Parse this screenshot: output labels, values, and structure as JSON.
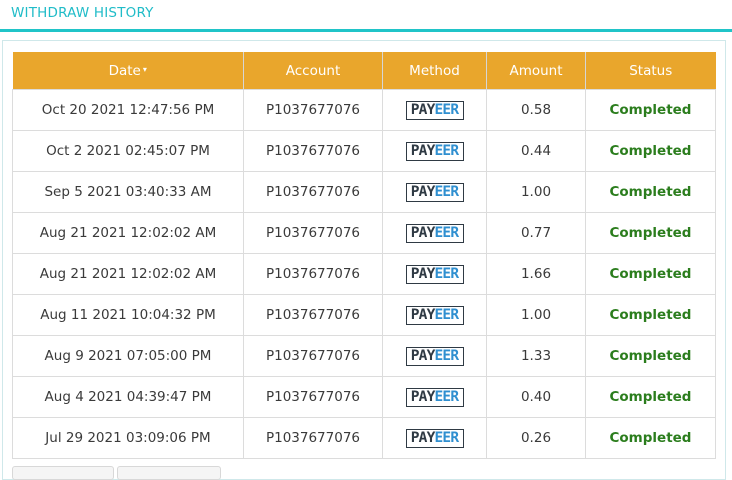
{
  "header": {
    "title": "WITHDRAW HISTORY"
  },
  "table": {
    "columns": [
      "Date",
      "Account",
      "Method",
      "Amount",
      "Status"
    ],
    "sort_indicator": "▾",
    "rows": [
      {
        "date": "Oct 20 2021 12:47:56 PM",
        "account": "P1037677076",
        "method": "PAYEER",
        "amount": "0.58",
        "status": "Completed"
      },
      {
        "date": "Oct 2 2021 02:45:07 PM",
        "account": "P1037677076",
        "method": "PAYEER",
        "amount": "0.44",
        "status": "Completed"
      },
      {
        "date": "Sep 5 2021 03:40:33 AM",
        "account": "P1037677076",
        "method": "PAYEER",
        "amount": "1.00",
        "status": "Completed"
      },
      {
        "date": "Aug 21 2021 12:02:02 AM",
        "account": "P1037677076",
        "method": "PAYEER",
        "amount": "0.77",
        "status": "Completed"
      },
      {
        "date": "Aug 21 2021 12:02:02 AM",
        "account": "P1037677076",
        "method": "PAYEER",
        "amount": "1.66",
        "status": "Completed"
      },
      {
        "date": "Aug 11 2021 10:04:32 PM",
        "account": "P1037677076",
        "method": "PAYEER",
        "amount": "1.00",
        "status": "Completed"
      },
      {
        "date": "Aug 9 2021 07:05:00 PM",
        "account": "P1037677076",
        "method": "PAYEER",
        "amount": "1.33",
        "status": "Completed"
      },
      {
        "date": "Aug 4 2021 04:39:47 PM",
        "account": "P1037677076",
        "method": "PAYEER",
        "amount": "0.40",
        "status": "Completed"
      },
      {
        "date": "Jul 29 2021 03:09:06 PM",
        "account": "P1037677076",
        "method": "PAYEER",
        "amount": "0.26",
        "status": "Completed"
      }
    ]
  },
  "colors": {
    "accent": "#20c4c8",
    "header_bg": "#e9a62c",
    "status_completed": "#2b7d1d",
    "payeer_blue": "#2f8fd0"
  },
  "icons": {
    "method_logo": "payeer-logo"
  }
}
